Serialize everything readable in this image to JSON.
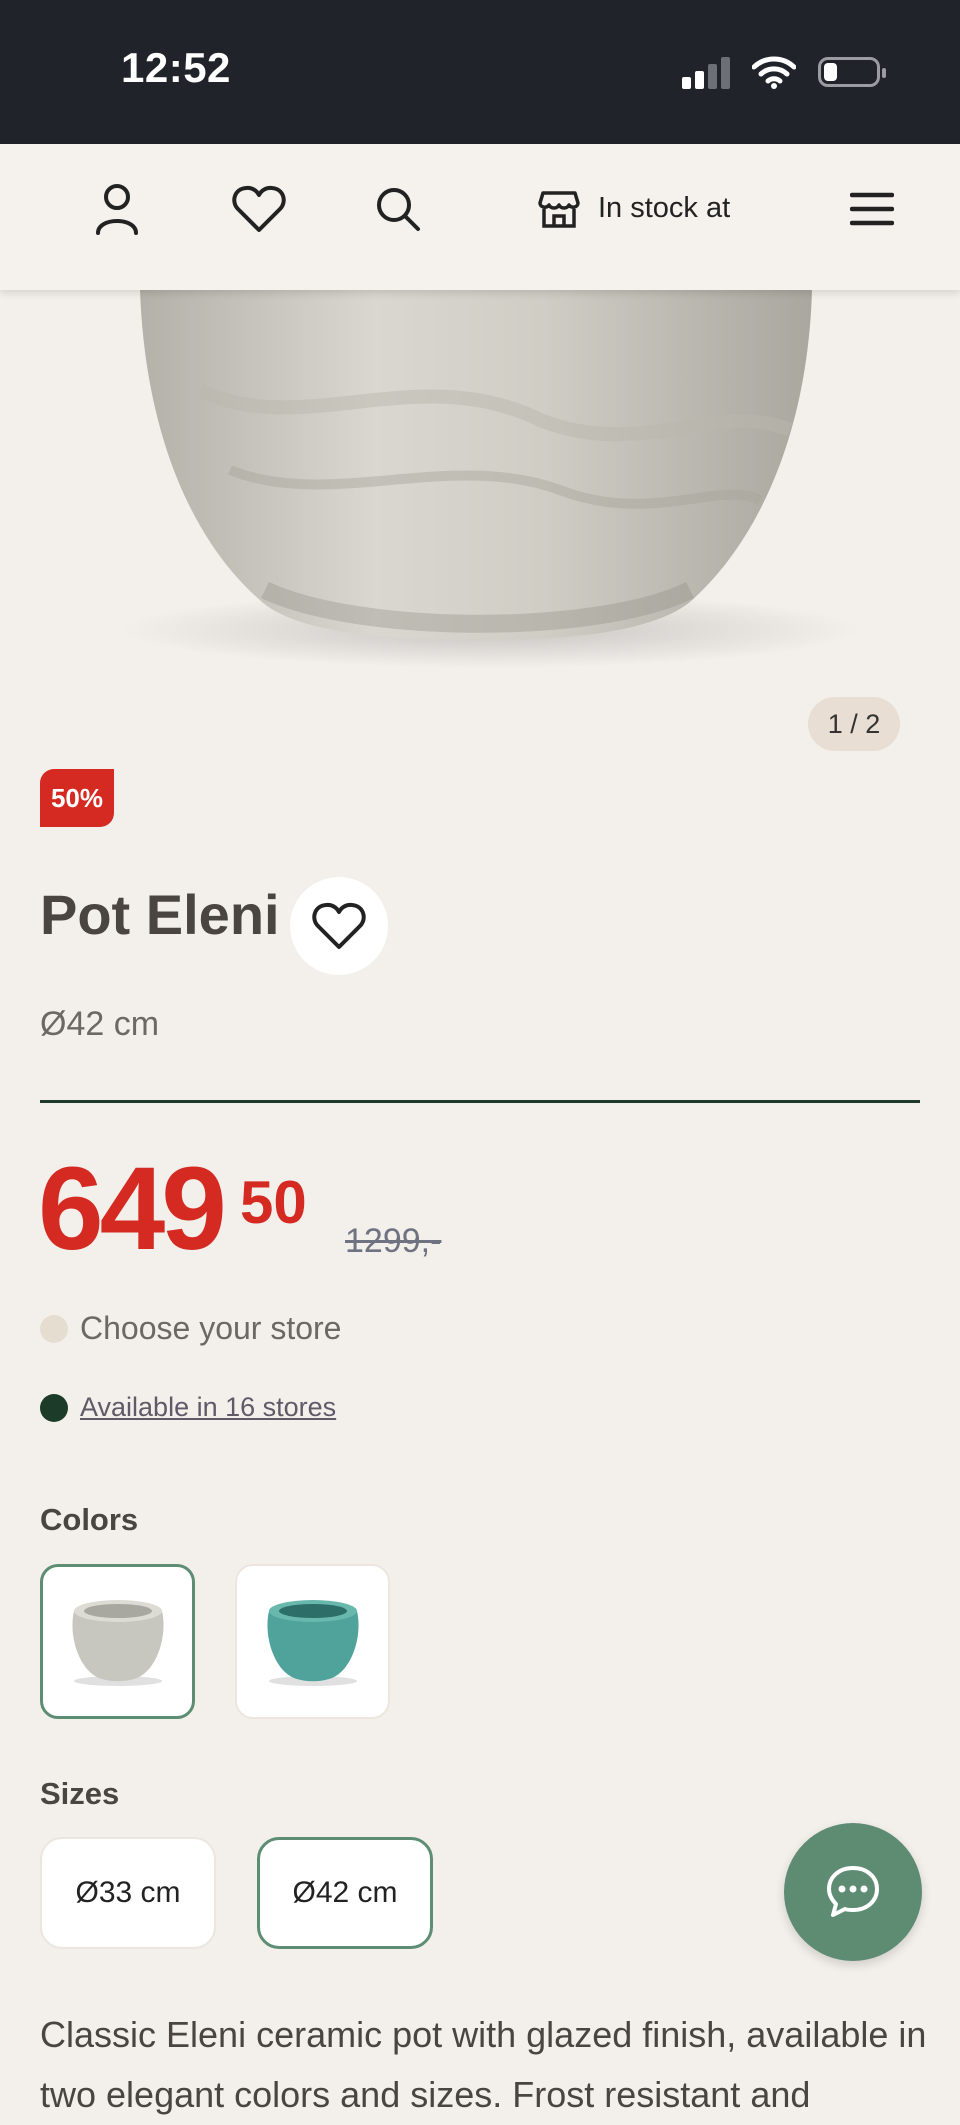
{
  "status_bar": {
    "time": "12:52"
  },
  "nav": {
    "in_stock_label": "In stock at",
    "icons": [
      "account-icon",
      "heart-icon",
      "search-icon",
      "store-icon",
      "menu-icon"
    ]
  },
  "gallery": {
    "counter": "1 / 2"
  },
  "product": {
    "discount_badge": "50%",
    "name": "Pot Eleni",
    "size_subtitle": "Ø42 cm",
    "price_integer": "649",
    "price_decimal": "50",
    "original_price": "1299,-"
  },
  "availability": {
    "choose_store": "Choose your store",
    "available_link": "Available in 16 stores"
  },
  "colors": {
    "label": "Colors",
    "options": [
      {
        "name": "grey-glaze",
        "selected": true,
        "color": "#c8c7bf"
      },
      {
        "name": "turquoise-glaze",
        "selected": false,
        "color": "#4fa39b"
      }
    ]
  },
  "sizes": {
    "label": "Sizes",
    "options": [
      {
        "label": "Ø33 cm",
        "selected": false
      },
      {
        "label": "Ø42 cm",
        "selected": true
      }
    ]
  },
  "description": "Classic Eleni ceramic pot with glazed finish, available in two elegant colors and sizes. Frost resistant and",
  "colors_theme": {
    "accent_red": "#d42a21",
    "accent_green": "#5e8c73",
    "dark_green": "#1e3a2b",
    "background": "#f3efeb"
  }
}
